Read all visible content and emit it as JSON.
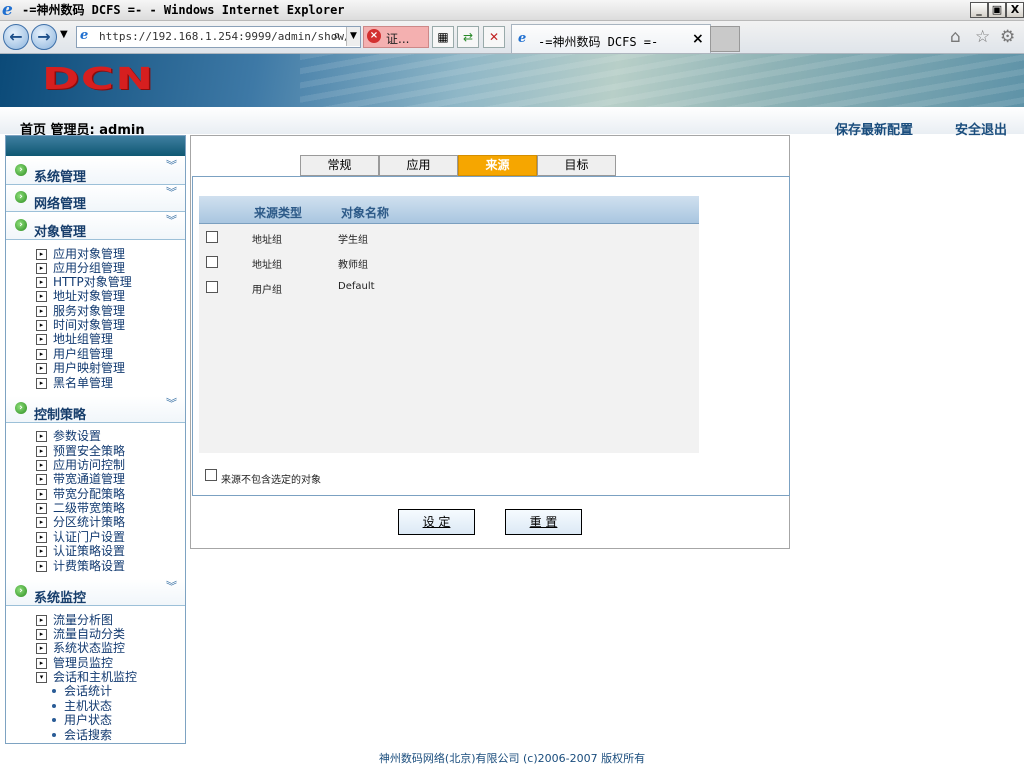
{
  "window": {
    "title": "-=神州数码 DCFS =- - Windows Internet Explorer",
    "minimize": "_",
    "restore": "▣",
    "close": "X"
  },
  "browser": {
    "back_icon": "back-arrow-icon",
    "forward_icon": "forward-arrow-icon",
    "address": "https://192.168.1.254:9999/admin/show/",
    "cert_label": "证...",
    "tab_title": "-=神州数码 DCFS =-",
    "tab_close": "×"
  },
  "banner": {
    "logo": "DCN"
  },
  "header": {
    "breadcrumb": "首页 管理员: admin",
    "save_config": "保存最新配置",
    "logout": "安全退出"
  },
  "sidebar": {
    "sections": [
      {
        "label": "系统管理"
      },
      {
        "label": "网络管理"
      },
      {
        "label": "对象管理",
        "items": [
          "应用对象管理",
          "应用分组管理",
          "HTTP对象管理",
          "地址对象管理",
          "服务对象管理",
          "时间对象管理",
          "地址组管理",
          "用户组管理",
          "用户映射管理",
          "黑名单管理"
        ]
      },
      {
        "label": "控制策略",
        "items": [
          "参数设置",
          "预置安全策略",
          "应用访问控制",
          "带宽通道管理",
          "带宽分配策略",
          "二级带宽策略",
          "分区统计策略",
          "认证门户设置",
          "认证策略设置",
          "计费策略设置"
        ]
      },
      {
        "label": "系统监控",
        "items": [
          "流量分析图",
          "流量自动分类",
          "系统状态监控",
          "管理员监控",
          "会话和主机监控"
        ],
        "subitems": [
          "会话统计",
          "主机状态",
          "用户状态",
          "会话搜索"
        ]
      }
    ]
  },
  "content": {
    "tabs": [
      "常规",
      "应用",
      "来源",
      "目标"
    ],
    "active_tab": "来源",
    "table": {
      "headers": [
        "来源类型",
        "对象名称"
      ],
      "rows": [
        {
          "type": "地址组",
          "name": "学生组"
        },
        {
          "type": "地址组",
          "name": "教师组"
        },
        {
          "type": "用户组",
          "name": "Default"
        }
      ]
    },
    "exclude_label": "来源不包含选定的对象",
    "set_button": "设 定",
    "reset_button": "重 置"
  },
  "footer": {
    "text": "神州数码网络(北京)有限公司 (c)2006-2007 版权所有"
  },
  "colors": {
    "active_tab": "#f6a600",
    "logo_red": "#d61f1f",
    "nav_text": "#163d6b"
  }
}
